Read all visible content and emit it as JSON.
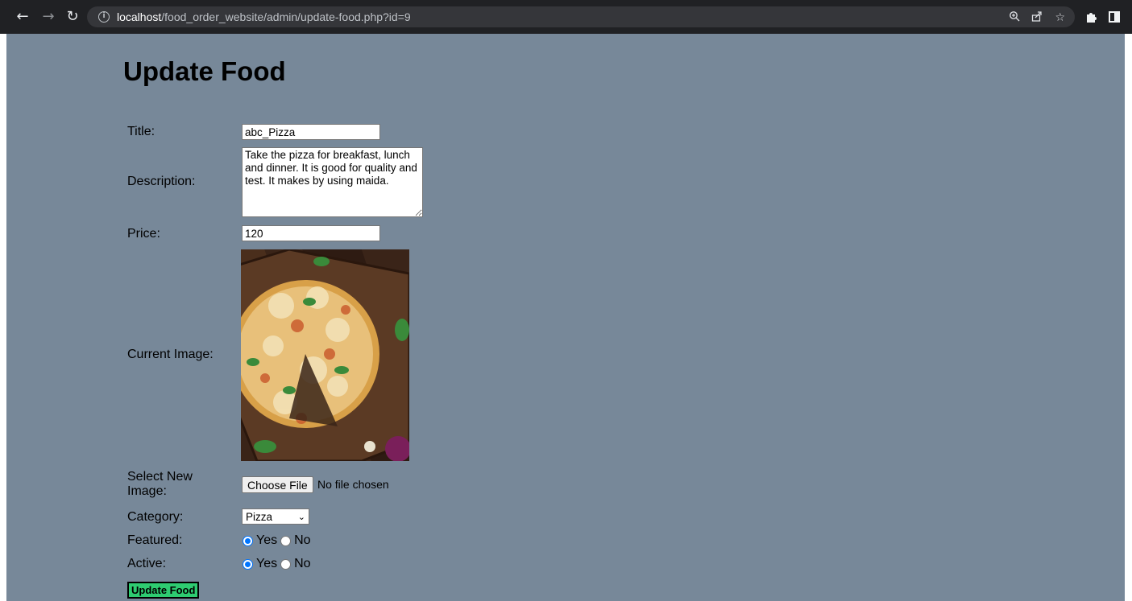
{
  "browser": {
    "url_host": "localhost",
    "url_path": "/food_order_website/admin/update-food.php?id=9"
  },
  "page": {
    "heading": "Update Food",
    "background": "#778899"
  },
  "form": {
    "title_label": "Title:",
    "title_value": "abc_Pizza",
    "description_label": "Description:",
    "description_value": "Take the pizza for breakfast, lunch and dinner. It is good for quality and test. It makes by using maida.",
    "price_label": "Price:",
    "price_value": "120",
    "current_image_label": "Current Image:",
    "new_image_label": "Select New Image:",
    "file_button_label": "Choose File",
    "file_status": "No file chosen",
    "category_label": "Category:",
    "category_selected": "Pizza",
    "featured_label": "Featured:",
    "featured_value": "Yes",
    "active_label": "Active:",
    "active_value": "Yes",
    "yes_label": "Yes",
    "no_label": "No",
    "submit_label": "Update Food",
    "submit_color": "#2ecc71"
  }
}
